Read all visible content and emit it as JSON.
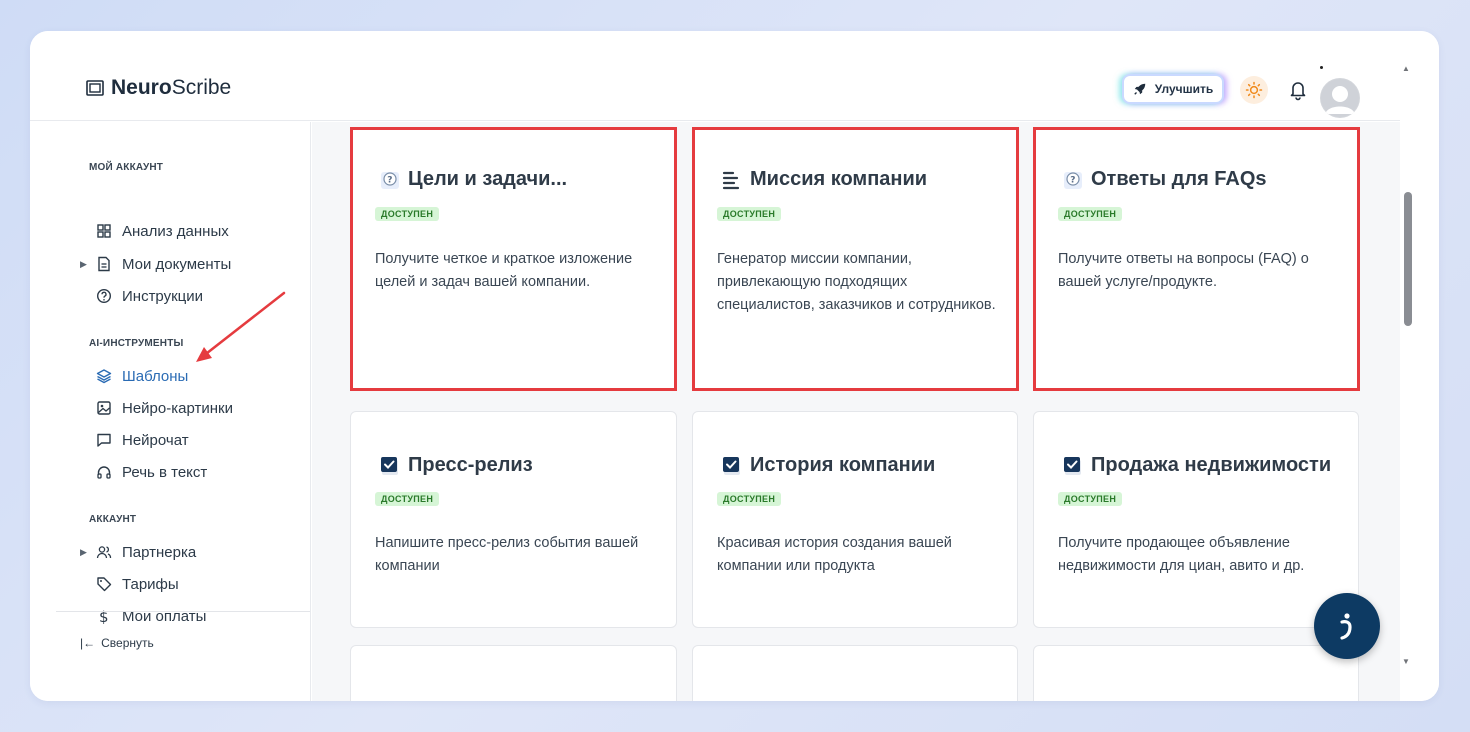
{
  "app": {
    "logo_bold": "Neuro",
    "logo_light": "Scribe"
  },
  "header": {
    "upgrade_label": "Улучшить"
  },
  "sidebar": {
    "sections": [
      {
        "label": "МОЙ АККАУНТ"
      },
      {
        "label": "AI-ИНСТРУМЕНТЫ"
      },
      {
        "label": "АККАУНТ"
      }
    ],
    "items": [
      {
        "label": "Анализ данных",
        "icon": "grid-icon"
      },
      {
        "label": "Мои документы",
        "icon": "document-icon"
      },
      {
        "label": "Инструкции",
        "icon": "help-icon"
      },
      {
        "label": "Шаблоны",
        "icon": "layers-icon"
      },
      {
        "label": "Нейро-картинки",
        "icon": "image-icon"
      },
      {
        "label": "Нейрочат",
        "icon": "chat-icon"
      },
      {
        "label": "Речь в текст",
        "icon": "headphones-icon"
      },
      {
        "label": "Партнерка",
        "icon": "users-icon"
      },
      {
        "label": "Тарифы",
        "icon": "tag-icon"
      },
      {
        "label": "Мои оплаты",
        "icon": "dollar-icon"
      }
    ],
    "collapse_label": "Свернуть"
  },
  "cards": [
    {
      "title": "Цели и задачи...",
      "badge": "ДОСТУПЕН",
      "desc": "Получите четкое и краткое изложение целей и задач вашей компании.",
      "icon": "question-icon"
    },
    {
      "title": "Миссия компании",
      "badge": "ДОСТУПЕН",
      "desc": "Генератор миссии компании, привлекающую подходящих специалистов, заказчиков и сотрудников.",
      "icon": "lines-icon"
    },
    {
      "title": "Ответы для FAQs",
      "badge": "ДОСТУПЕН",
      "desc": "Получите ответы на вопросы (FAQ) о вашей услуге/продукте.",
      "icon": "question-icon"
    },
    {
      "title": "Пресс-релиз",
      "badge": "ДОСТУПЕН",
      "desc": "Напишите пресс-релиз события вашей компании",
      "icon": "check-icon"
    },
    {
      "title": "История компании",
      "badge": "ДОСТУПЕН",
      "desc": "Красивая история создания вашей компании или продукта",
      "icon": "check-icon"
    },
    {
      "title": "Продажа недвижимости",
      "badge": "ДОСТУПЕН",
      "desc": "Получите продающее объявление недвижимости для циан, авито и др.",
      "icon": "check-icon"
    }
  ],
  "colors": {
    "accent": "#2a6bb4",
    "highlight": "#e53b3f",
    "badge_bg": "#d6f5d6",
    "badge_text": "#2a7a2a",
    "chat_button": "#0d3a63"
  }
}
